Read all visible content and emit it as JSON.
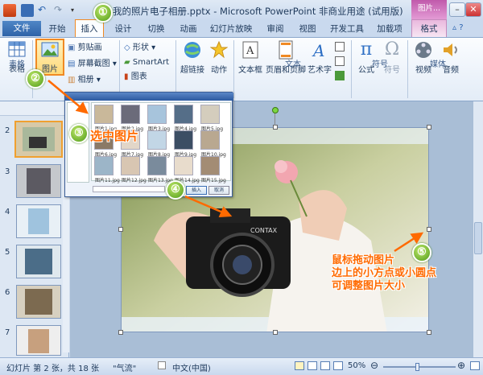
{
  "window": {
    "title": "我的照片电子相册.pptx - Microsoft PowerPoint 非商业用途 (试用版)",
    "context_tab_group": "图片..."
  },
  "tabs": [
    "文件",
    "开始",
    "插入",
    "设计",
    "切换",
    "动画",
    "幻灯片放映",
    "审阅",
    "视图",
    "开发工具",
    "加载项",
    "格式"
  ],
  "ribbon": {
    "groups": {
      "tables": {
        "label": "表格",
        "table_btn": "表格"
      },
      "images": {
        "picture_btn": "图片",
        "clipart": "剪贴画",
        "screenshot": "屏幕截图",
        "album": "相册"
      },
      "illustrations": {
        "shapes": "形状",
        "smartart": "SmartArt",
        "chart": "图表"
      },
      "links": {
        "hyperlink": "超链接",
        "action": "动作"
      },
      "text": {
        "label": "文本",
        "textbox": "文本框",
        "header_footer": "页眉和页脚",
        "wordart": "艺术字"
      },
      "symbols": {
        "label": "符号",
        "equation": "公式",
        "symbol": "符号"
      },
      "media": {
        "label": "媒体",
        "video": "视频",
        "audio": "音频"
      }
    }
  },
  "slides": [
    {
      "num": "2",
      "selected": true
    },
    {
      "num": "3",
      "selected": false
    },
    {
      "num": "4",
      "selected": false
    },
    {
      "num": "5",
      "selected": false
    },
    {
      "num": "6",
      "selected": false
    },
    {
      "num": "7",
      "selected": false
    }
  ],
  "dialog": {
    "thumb_labels": [
      "图片1.jpg",
      "图片2.jpg",
      "图片3.jpg",
      "图片4.jpg",
      "图片5.jpg",
      "图片6.jpg",
      "图片7.jpg",
      "图片8.jpg",
      "图片9.jpg",
      "图片10.jpg",
      "图片11.jpg",
      "图片12.jpg",
      "图片13.jpg",
      "图片14.jpg",
      "图片15.jpg"
    ],
    "insert_btn": "插入",
    "cancel_btn": "取消"
  },
  "callouts": {
    "step1": "①",
    "step2": "②",
    "step3": "③",
    "step4": "④",
    "step5": "⑤",
    "select_picture": "选中图片",
    "resize_hint": [
      "鼠标拖动图片",
      "边上的小方点或小圆点",
      "可调整图片大小"
    ]
  },
  "status": {
    "slide_info": "幻灯片 第 2 张，共 18 张",
    "theme": "\"气流\"",
    "language": "中文(中国)",
    "zoom": "50%"
  },
  "colors": {
    "accent": "#f08a24",
    "annotation": "#ff6a00",
    "badge": "#5aa81f",
    "file_tab": "#2e63a8"
  }
}
